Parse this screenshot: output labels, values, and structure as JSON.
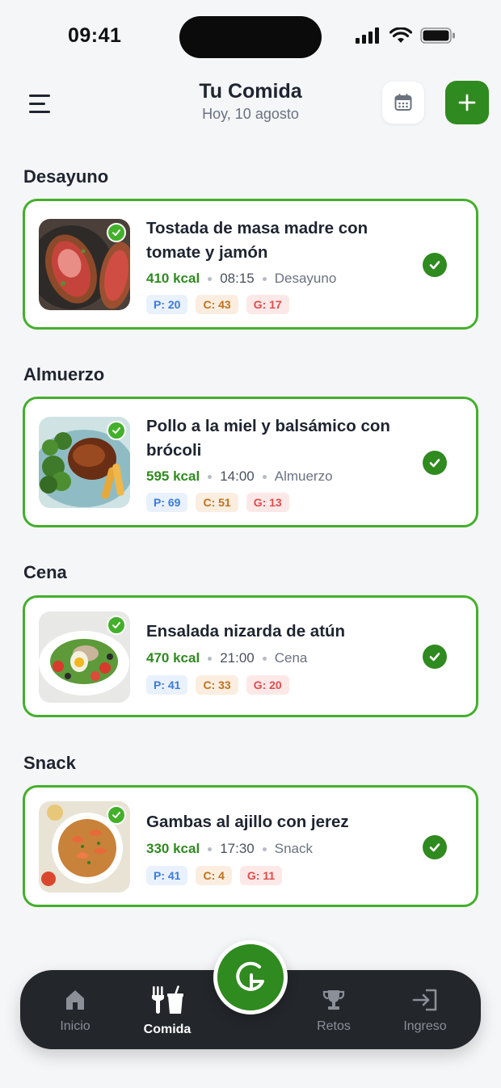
{
  "status": {
    "time": "09:41"
  },
  "header": {
    "title": "Tu Comida",
    "subtitle": "Hoy, 10 agosto",
    "icons": {
      "menu": "menu-icon",
      "calendar": "calendar-icon",
      "add": "plus-icon"
    }
  },
  "sections": [
    {
      "title": "Desayuno",
      "meal": {
        "name": "Tostada de masa madre con tomate y jamón",
        "kcal": "410 kcal",
        "time": "08:15",
        "type": "Desayuno",
        "p": "P: 20",
        "c": "C: 43",
        "g": "G: 17"
      }
    },
    {
      "title": "Almuerzo",
      "meal": {
        "name": "Pollo a la miel y balsámico con brócoli",
        "kcal": "595 kcal",
        "time": "14:00",
        "type": "Almuerzo",
        "p": "P: 69",
        "c": "C: 51",
        "g": "G: 13"
      }
    },
    {
      "title": "Cena",
      "meal": {
        "name": "Ensalada nizarda de atún",
        "kcal": "470 kcal",
        "time": "21:00",
        "type": "Cena",
        "p": "P: 41",
        "c": "C: 33",
        "g": "G: 20"
      }
    },
    {
      "title": "Snack",
      "meal": {
        "name": "Gambas al ajillo con jerez",
        "kcal": "330 kcal",
        "time": "17:30",
        "type": "Snack",
        "p": "P: 41",
        "c": "C: 4",
        "g": "G: 11"
      }
    }
  ],
  "nav": {
    "items": [
      {
        "label": "Inicio",
        "icon": "home-icon"
      },
      {
        "label": "Comida",
        "icon": "food-icon",
        "active": true
      },
      {
        "label": "Retos",
        "icon": "trophy-icon"
      },
      {
        "label": "Ingreso",
        "icon": "login-icon"
      }
    ],
    "center_icon": "app-logo-icon"
  },
  "colors": {
    "accent": "#2f8a1f",
    "card_border": "#43b02a",
    "background": "#f5f6f8",
    "nav_bg": "#23262b"
  }
}
